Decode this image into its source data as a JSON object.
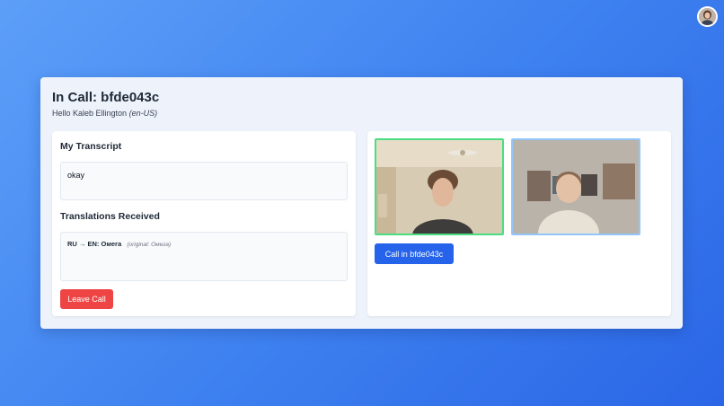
{
  "header": {
    "title": "In Call: bfde043c",
    "greeting_prefix": "Hello Kaleb Ellington",
    "locale": "(en-US)"
  },
  "transcript": {
    "heading": "My Transcript",
    "text": "okay"
  },
  "translations": {
    "heading": "Translations Received",
    "items": [
      {
        "lang": "RU → EN: Омега",
        "original": "(original: Омега)"
      }
    ]
  },
  "actions": {
    "leave_label": "Leave Call",
    "call_label": "Call in bfde043c"
  },
  "colors": {
    "leave": "#ef4444",
    "call": "#2563eb",
    "local_video_border": "#4ade80",
    "remote_video_border": "#93c5fd"
  },
  "icons": {
    "avatar": "user-avatar-icon"
  }
}
